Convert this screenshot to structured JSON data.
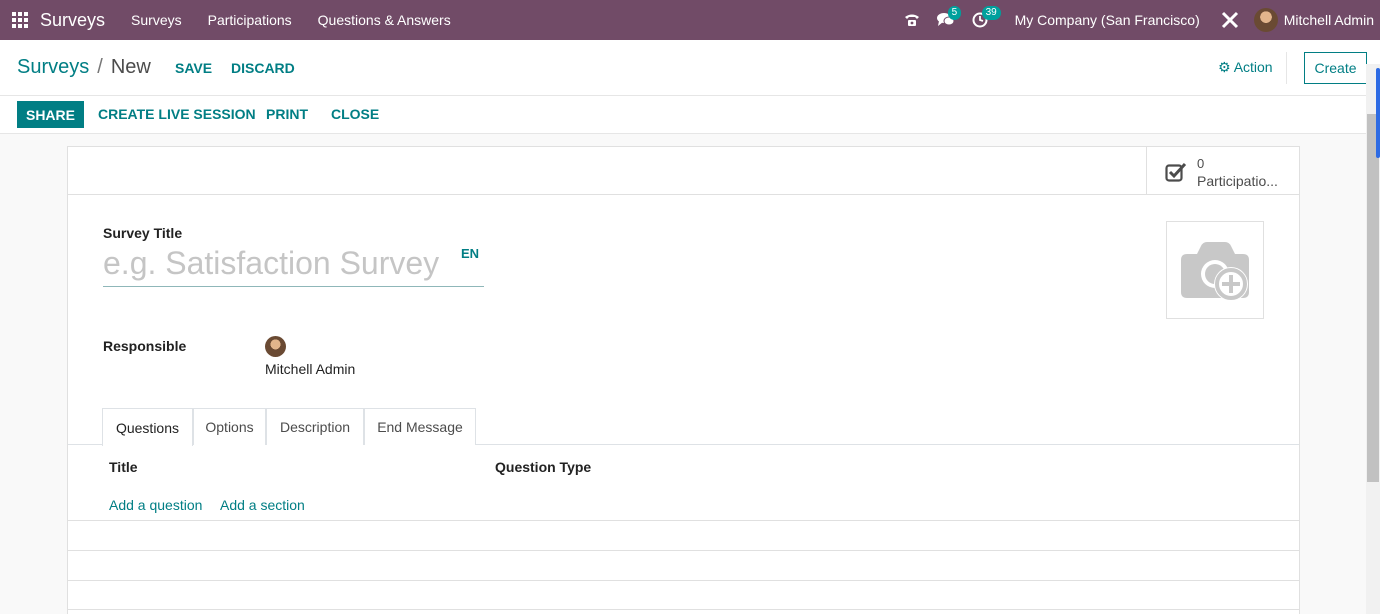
{
  "navbar": {
    "brand": "Surveys",
    "menus": [
      "Surveys",
      "Participations",
      "Questions & Answers"
    ],
    "messages_count": "5",
    "activities_count": "39",
    "company": "My Company (San Francisco)",
    "user": "Mitchell Admin"
  },
  "control_panel": {
    "breadcrumb_root": "Surveys",
    "breadcrumb_current": "New",
    "save_label": "SAVE",
    "discard_label": "DISCARD",
    "action_label": "Action",
    "create_label": "Create"
  },
  "statusbar": {
    "share_label": "SHARE",
    "live_session_label": "CREATE LIVE SESSION",
    "print_label": "PRINT",
    "close_label": "CLOSE"
  },
  "form": {
    "participations_value": "0",
    "participations_label": "Participatio...",
    "survey_title_label": "Survey Title",
    "survey_title_placeholder": "e.g. Satisfaction Survey",
    "lang_tag": "EN",
    "responsible_label": "Responsible",
    "responsible_value": "Mitchell Admin",
    "tabs": [
      "Questions",
      "Options",
      "Description",
      "End Message"
    ],
    "columns": [
      "Title",
      "Question Type"
    ],
    "add_question_label": "Add a question",
    "add_section_label": "Add a section"
  },
  "colors": {
    "navbar": "#714b67",
    "accent": "#017e84",
    "badge": "#00a09d"
  },
  "icons": [
    "apps-grid-icon",
    "phone-icon",
    "chat-icon",
    "clock-icon",
    "tools-icon",
    "gear-icon",
    "checkbox-icon",
    "camera-plus-icon"
  ]
}
